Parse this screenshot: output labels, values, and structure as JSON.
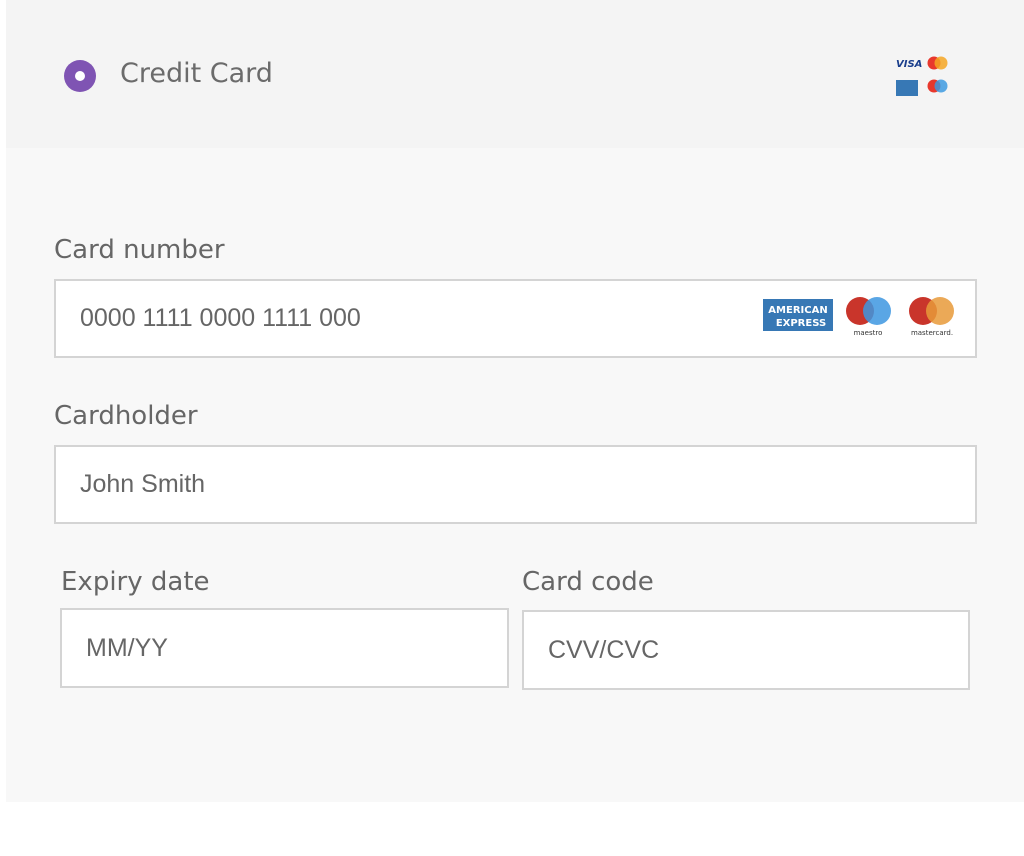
{
  "header": {
    "title": "Credit Card",
    "selected": true,
    "accepted_cards": [
      "visa",
      "mastercard",
      "american-express",
      "maestro"
    ]
  },
  "form": {
    "card_number": {
      "label": "Card number",
      "placeholder": "0000 1111 0000 1111 000",
      "logos": {
        "amex": "AMERICAN EXPRESS",
        "maestro": "maestro",
        "mastercard": "mastercard."
      }
    },
    "cardholder": {
      "label": "Cardholder",
      "placeholder": "John Smith"
    },
    "expiry": {
      "label": "Expiry date",
      "placeholder": "MM/YY"
    },
    "cvc": {
      "label": "Card code",
      "placeholder": "CVV/CVC"
    }
  },
  "colors": {
    "accent": "#7f54b3"
  }
}
